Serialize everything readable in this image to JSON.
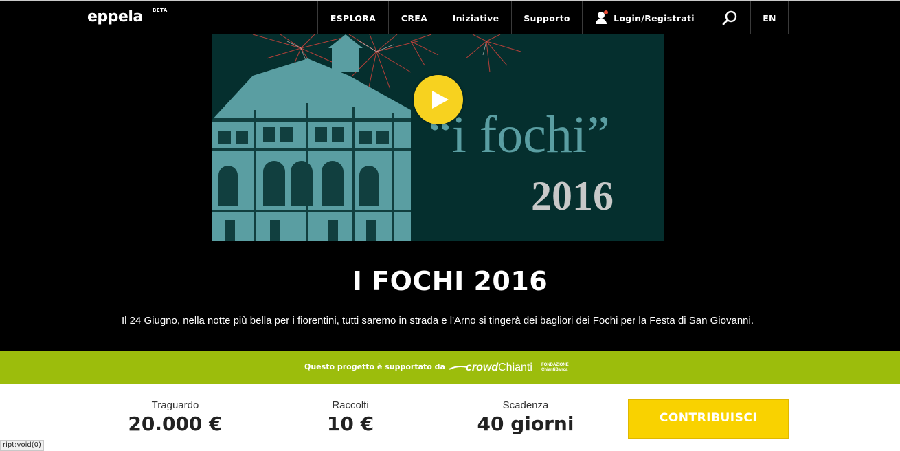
{
  "header": {
    "logo_text": "eppela",
    "logo_badge": "BETA",
    "nav": {
      "esplora": "ESPLORA",
      "crea": "CREA",
      "iniziative": "Iniziative",
      "supporto": "Supporto",
      "login": "Login/Registrati",
      "language": "EN"
    },
    "icons": {
      "user": "user-icon",
      "search": "search-icon"
    }
  },
  "video": {
    "title_text": "“i fochi”",
    "year_text": "2016",
    "play_icon": "play-icon"
  },
  "project": {
    "title": "I FOCHI 2016",
    "description": "Il 24 Giugno, nella notte più bella per i fiorentini, tutti saremo in strada e l'Arno si tingerà dei bagliori dei Fochi per la Festa di San Giovanni."
  },
  "sponsor": {
    "text": "Questo progetto è supportato da",
    "logo_part1": "crowd",
    "logo_part2": "Chianti",
    "logo_sub_line1": "FONDAZIONE",
    "logo_sub_line2": "ChiantiBanca"
  },
  "stats": {
    "goal_label": "Traguardo",
    "goal_value": "20.000 €",
    "raised_label": "Raccolti",
    "raised_value": "10 €",
    "deadline_label": "Scadenza",
    "deadline_value": "40 giorni"
  },
  "cta": {
    "contribute_label": "CONTRIBUISCI"
  },
  "status_bar": {
    "text": "ript:void(0)"
  },
  "colors": {
    "accent_green": "#9cbd0c",
    "accent_yellow": "#f9d200",
    "video_bg": "#052f2e",
    "video_text": "#5a9ea2"
  }
}
